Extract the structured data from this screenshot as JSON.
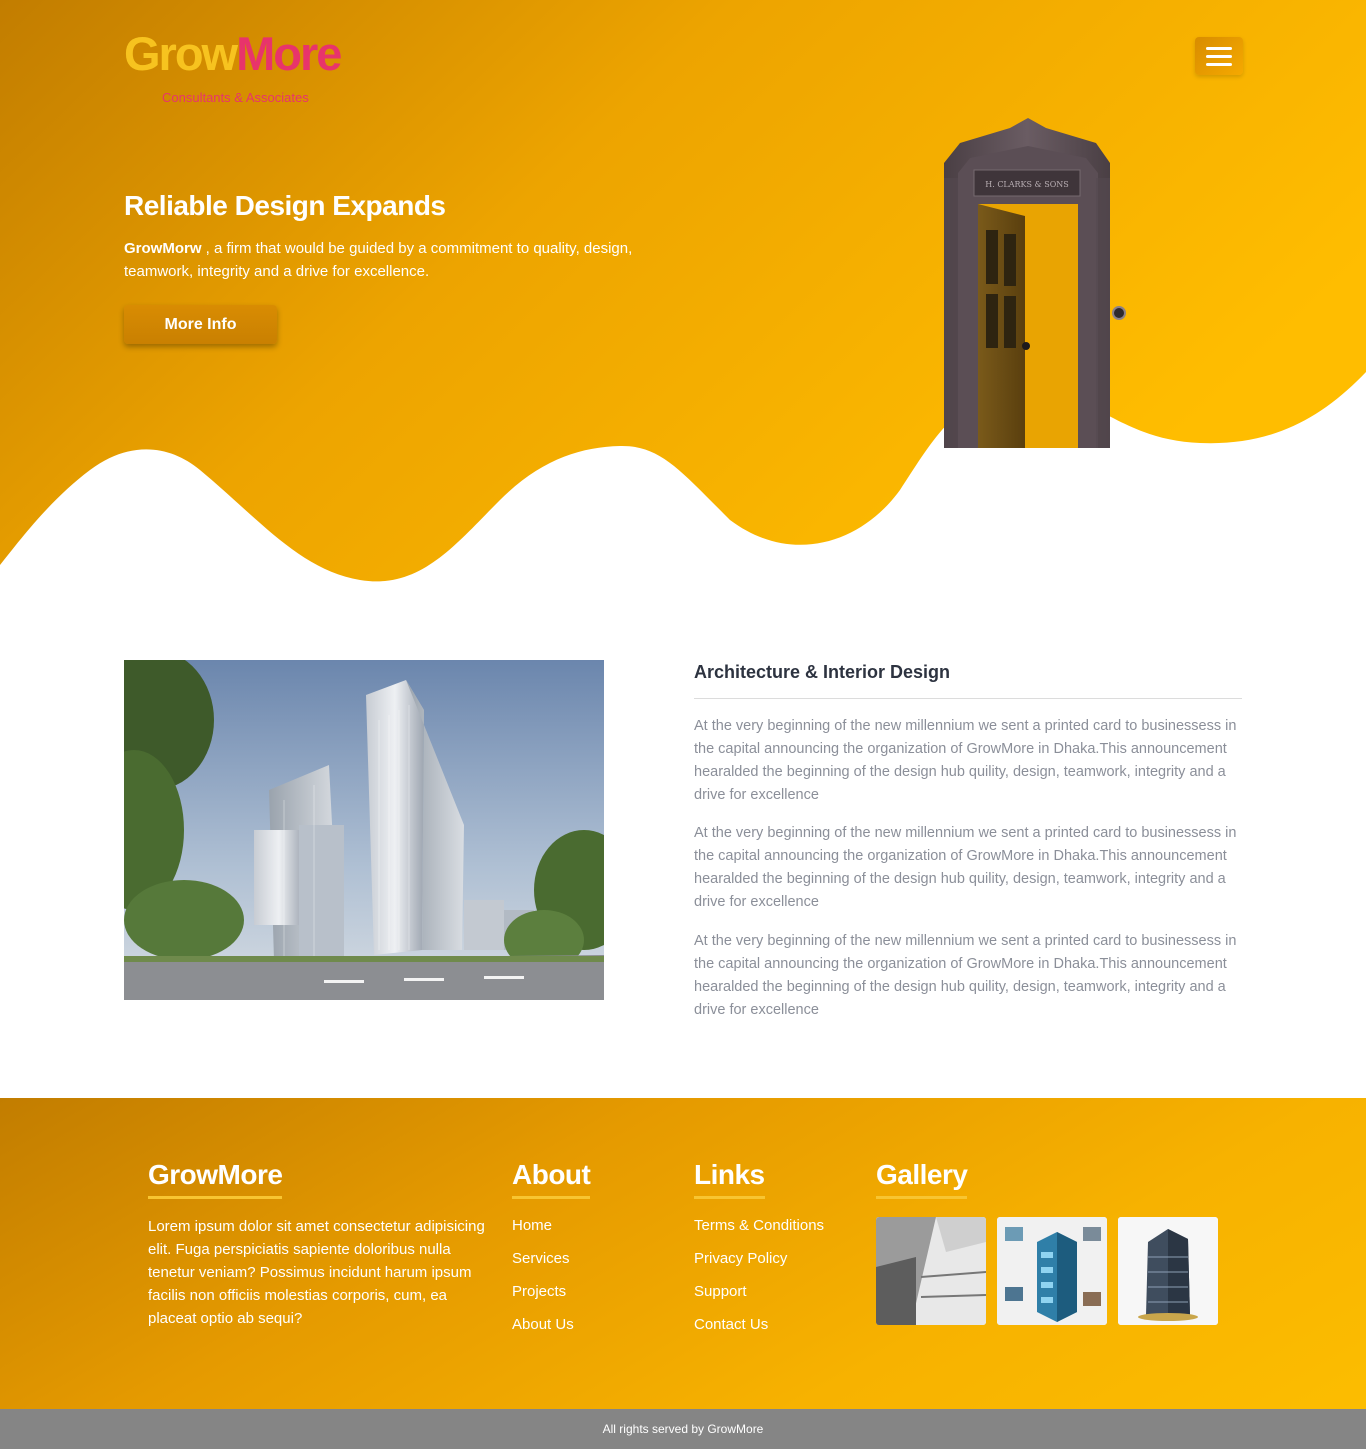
{
  "colors": {
    "accent": "#f5a900",
    "accent_dark": "#c27d00",
    "logo_yellow": "#f7c31f",
    "logo_pink": "#e8346b",
    "footer_bar": "#858585"
  },
  "header": {
    "logo_part1": "Grow",
    "logo_part2": "More",
    "tagline": "Consultants & Associates",
    "menu_icon": "hamburger-icon"
  },
  "hero": {
    "title": "Reliable Design Expands",
    "brand": "GrowMorw",
    "description": " , a firm that would be guided by a commitment to quality, design, teamwork, integrity and a drive for excellence.",
    "button_label": "More Info"
  },
  "about": {
    "title": "Architecture & Interior Design",
    "paragraphs": [
      "At the very beginning of the new millennium we sent a printed card to businessess in the capital announcing the organization of GrowMore in Dhaka.This announcement hearalded the beginning of the design hub quility, design, teamwork, integrity and a drive for excellence",
      "At the very beginning of the new millennium we sent a printed card to businessess in the capital announcing the organization of GrowMore in Dhaka.This announcement hearalded the beginning of the design hub quility, design, teamwork, integrity and a drive for excellence",
      "At the very beginning of the new millennium we sent a printed card to businessess in the capital announcing the organization of GrowMore in Dhaka.This announcement hearalded the beginning of the design hub quility, design, teamwork, integrity and a drive for excellence"
    ]
  },
  "footer": {
    "brand": {
      "heading": "GrowMore",
      "text": "Lorem ipsum dolor sit amet consectetur adipisicing elit. Fuga perspiciatis sapiente doloribus nulla tenetur veniam? Possimus incidunt harum ipsum facilis non officiis molestias corporis, cum, ea placeat optio ab sequi?"
    },
    "about": {
      "heading": "About",
      "items": [
        "Home",
        "Services",
        "Projects",
        "About Us"
      ]
    },
    "links": {
      "heading": "Links",
      "items": [
        "Terms & Conditions",
        "Privacy Policy",
        "Support",
        "Contact Us"
      ]
    },
    "gallery": {
      "heading": "Gallery"
    },
    "copyright": "All rights served by GrowMore"
  }
}
